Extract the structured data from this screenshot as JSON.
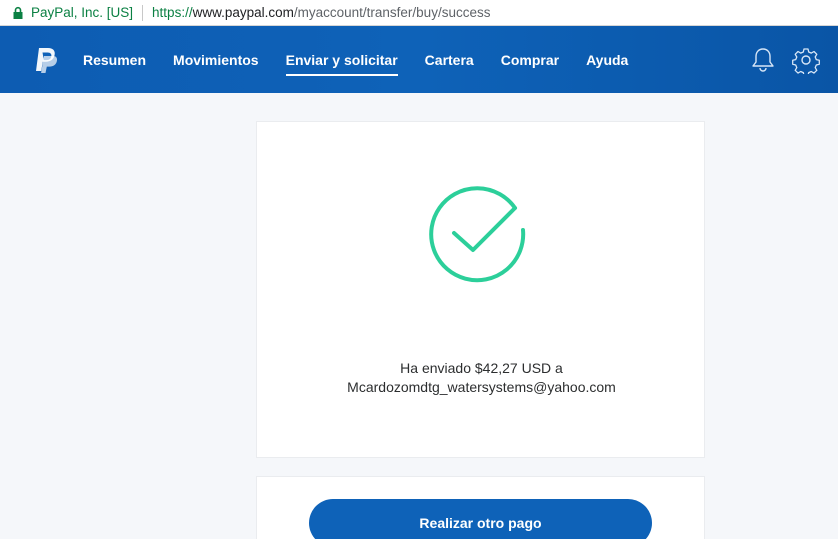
{
  "browser": {
    "site_identity": "PayPal, Inc. [US]",
    "url_scheme": "https://",
    "url_host": "www.paypal.com",
    "url_path": "/myaccount/transfer/buy/success"
  },
  "header": {
    "nav": [
      {
        "label": "Resumen"
      },
      {
        "label": "Movimientos"
      },
      {
        "label": "Enviar y solicitar"
      },
      {
        "label": "Cartera"
      },
      {
        "label": "Comprar"
      },
      {
        "label": "Ayuda"
      }
    ],
    "active_nav": "Enviar y solicitar",
    "icons": [
      "paypal-logo-icon",
      "bell-icon",
      "gear-icon"
    ]
  },
  "success": {
    "message_line1": "Ha enviado $42,27 USD a",
    "message_line2": "Mcardozomdtg_watersystems@yahoo.com",
    "icon": "check-circle-icon",
    "icon_color": "#2ccf9a"
  },
  "actions": {
    "primary_label": "Realizar otro pago"
  },
  "colors": {
    "brand_blue": "#0e62b8",
    "success_green": "#2ccf9a"
  }
}
